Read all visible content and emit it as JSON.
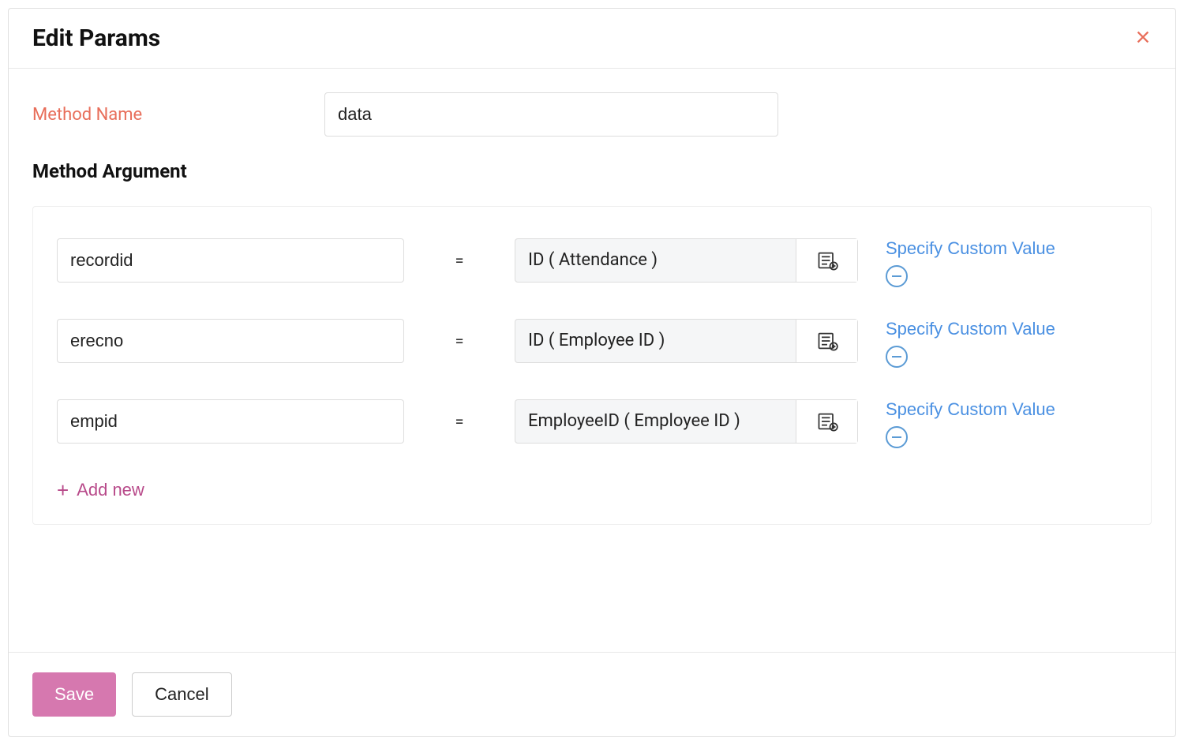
{
  "dialog": {
    "title": "Edit Params"
  },
  "methodName": {
    "label": "Method Name",
    "value": "data"
  },
  "section": {
    "title": "Method Argument"
  },
  "arguments": [
    {
      "key": "recordid",
      "equals": "=",
      "value": "ID ( Attendance )",
      "customLabel": "Specify Custom Value"
    },
    {
      "key": "erecno",
      "equals": "=",
      "value": "ID ( Employee ID )",
      "customLabel": "Specify Custom Value"
    },
    {
      "key": "empid",
      "equals": "=",
      "value": "EmployeeID ( Employee ID )",
      "customLabel": "Specify Custom Value"
    }
  ],
  "addNew": {
    "plus": "+",
    "label": "Add new"
  },
  "footer": {
    "save": "Save",
    "cancel": "Cancel"
  }
}
